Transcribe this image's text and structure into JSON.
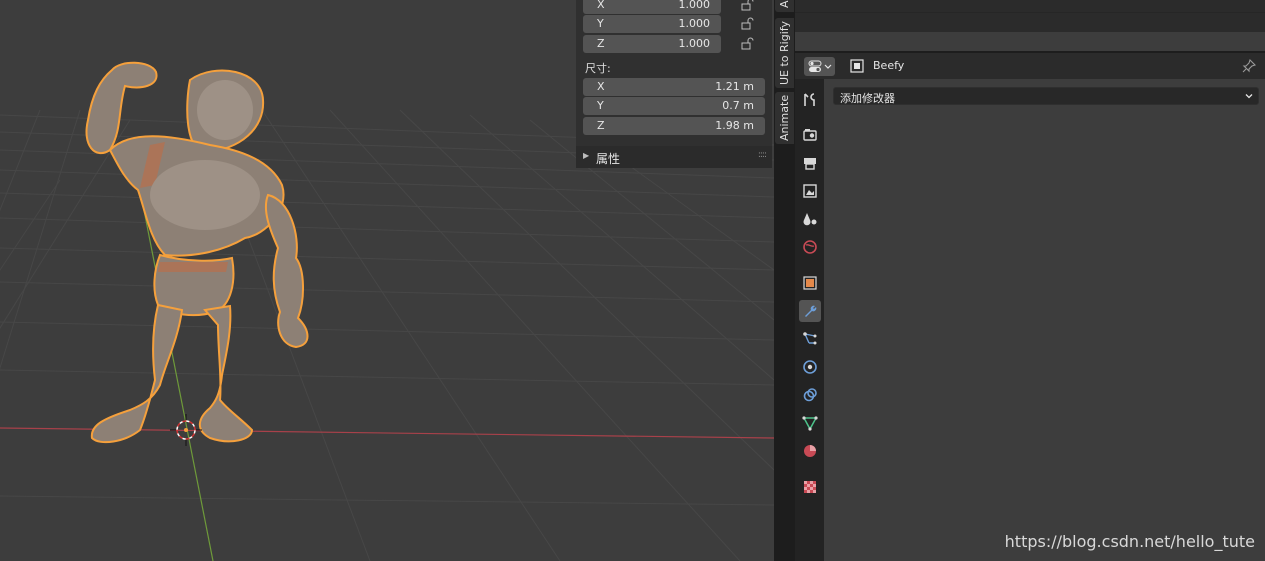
{
  "npanel": {
    "scale_rows": [
      {
        "axis": "X",
        "value": "1.000"
      },
      {
        "axis": "Y",
        "value": "1.000"
      },
      {
        "axis": "Z",
        "value": "1.000"
      }
    ],
    "dimensions_label": "尺寸:",
    "dimension_rows": [
      {
        "axis": "X",
        "value": "1.21 m"
      },
      {
        "axis": "Y",
        "value": "0.7 m"
      },
      {
        "axis": "Z",
        "value": "1.98 m"
      }
    ],
    "properties_section": "属性",
    "grip_glyph": "::::"
  },
  "vertical_tabs": [
    {
      "label": "A"
    },
    {
      "label": "UE to Rigify"
    },
    {
      "label": "Animate"
    }
  ],
  "properties_editor": {
    "object_name": "Beefy",
    "add_modifier_label": "添加修改器",
    "tabs": [
      {
        "name": "tool-icon"
      },
      {
        "name": "render-icon"
      },
      {
        "name": "output-icon"
      },
      {
        "name": "view-layer-icon"
      },
      {
        "name": "scene-icon"
      },
      {
        "name": "world-icon"
      },
      {
        "name": "object-icon"
      },
      {
        "name": "modifier-icon",
        "active": true
      },
      {
        "name": "particles-icon"
      },
      {
        "name": "physics-icon"
      },
      {
        "name": "constraints-icon"
      },
      {
        "name": "object-data-icon"
      },
      {
        "name": "material-icon"
      },
      {
        "name": "texture-icon"
      }
    ]
  },
  "watermark": "https://blog.csdn.net/hello_tute",
  "colors": {
    "viewport_bg": "#3d3d3d",
    "selection_outline": "#f5a03c",
    "x_axis": "#a8414a",
    "y_axis": "#6e9a3a",
    "active_tab": "#545454",
    "modifier_accent": "#6d9ed8"
  }
}
